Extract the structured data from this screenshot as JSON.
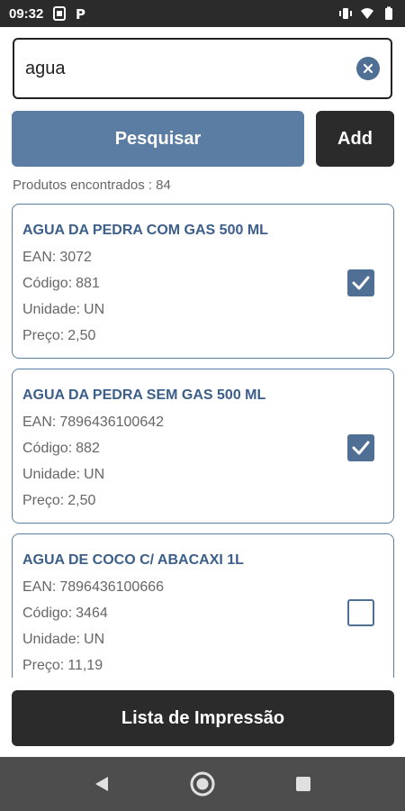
{
  "status_bar": {
    "time": "09:32",
    "left_icons": [
      "gallery-icon",
      "p-app-icon"
    ],
    "right_icons": [
      "vibrate-icon",
      "wifi-icon",
      "battery-icon"
    ]
  },
  "search": {
    "value": "agua",
    "placeholder": ""
  },
  "buttons": {
    "search_label": "Pesquisar",
    "add_label": "Add",
    "print_list_label": "Lista de Impressão"
  },
  "results": {
    "count_label": "Produtos encontrados :",
    "count": "84"
  },
  "labels": {
    "ean": "EAN:",
    "code": "Código:",
    "unit": "Unidade:",
    "price": "Preço:"
  },
  "products": [
    {
      "name": "AGUA DA PEDRA COM GAS 500 ML",
      "ean": "3072",
      "code": "881",
      "unit": "UN",
      "price": "2,50",
      "checked": true
    },
    {
      "name": "AGUA DA PEDRA SEM GAS 500 ML",
      "ean": "7896436100642",
      "code": "882",
      "unit": "UN",
      "price": "2,50",
      "checked": true
    },
    {
      "name": "AGUA DE COCO C/ ABACAXI 1L",
      "ean": "7896436100666",
      "code": "3464",
      "unit": "UN",
      "price": "11,19",
      "checked": false
    }
  ],
  "colors": {
    "accent": "#5b7ca3",
    "dark": "#2b2b2b",
    "title_blue": "#3b5e8a"
  },
  "nav": {
    "icons": [
      "back-icon",
      "home-icon",
      "recents-icon"
    ]
  }
}
